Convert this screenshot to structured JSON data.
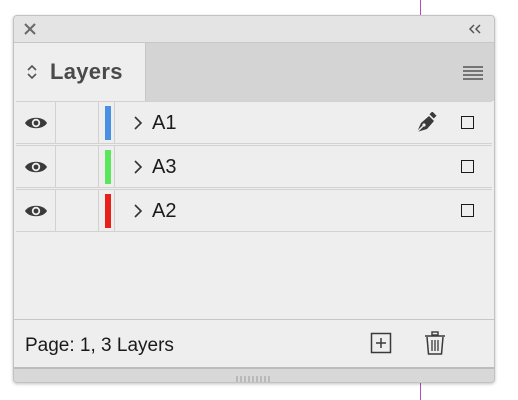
{
  "panel": {
    "tab_label": "Layers"
  },
  "layers": [
    {
      "name": "A1",
      "color": "#4a90e2",
      "has_pen": true
    },
    {
      "name": "A3",
      "color": "#5ce65c",
      "has_pen": false
    },
    {
      "name": "A2",
      "color": "#e8201a",
      "has_pen": false
    }
  ],
  "status": {
    "text": "Page: 1, 3 Layers"
  },
  "icons": {
    "close": "close-icon",
    "collapse": "double-chevron-left-icon",
    "tab_arrows": "updown-arrows-icon",
    "menu": "hamburger-menu-icon",
    "visibility": "eye-icon",
    "expand": "chevron-right-icon",
    "pen": "pen-nib-icon",
    "new_layer": "plus-square-icon",
    "delete": "trash-icon",
    "resize": "grip-icon"
  },
  "colors": {
    "guide": "#b34cc0",
    "panel_bg": "#eeeeee",
    "tab_bar": "#d4d4d4"
  }
}
